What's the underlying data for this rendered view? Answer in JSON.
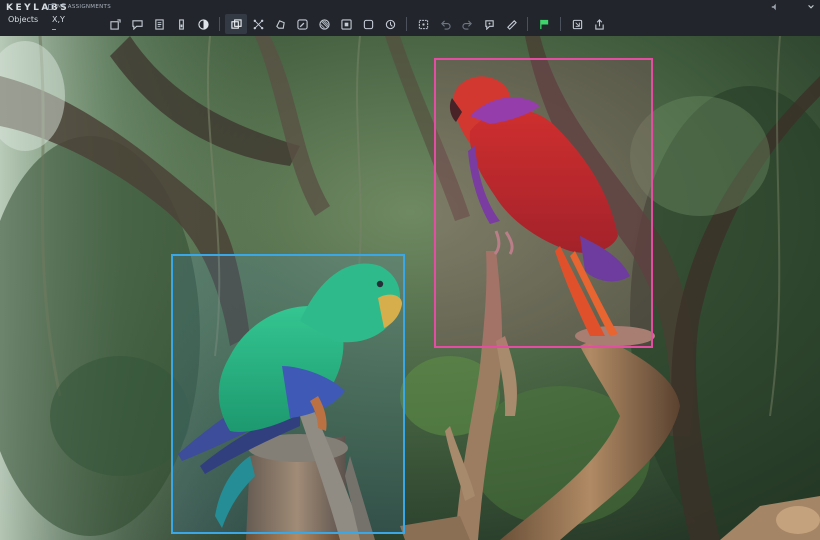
{
  "app": {
    "brand": "KEYLABS",
    "assignments_label": "MY ASSIGNMENTS"
  },
  "menu": {
    "objects_label": "Objects",
    "xy_label": "X,Y"
  },
  "toolbar_icons": [
    "new-object-icon",
    "comment-icon",
    "notes-icon",
    "brightness-icon",
    "contrast-icon",
    "bounding-box-tool-icon",
    "keypoints-tool-icon",
    "polygon-tool-icon",
    "brush-tool-icon",
    "mask-tool-icon",
    "cuboid-tool-icon",
    "rectangle-tool-icon",
    "rotate-tool-icon",
    "select-tool-icon",
    "undo-icon",
    "redo-icon",
    "ai-assist-icon",
    "ruler-icon",
    "flag-icon",
    "export-icon",
    "share-icon"
  ],
  "colors": {
    "toolbar_bg": "#22262c",
    "blue_box": "#3aa7e6",
    "pink_box": "#e24fa2",
    "flag_green": "#3fd36b"
  },
  "annotations": [
    {
      "label_color": "blue",
      "object": "green parrot"
    },
    {
      "label_color": "pink",
      "object": "red parrot"
    }
  ]
}
